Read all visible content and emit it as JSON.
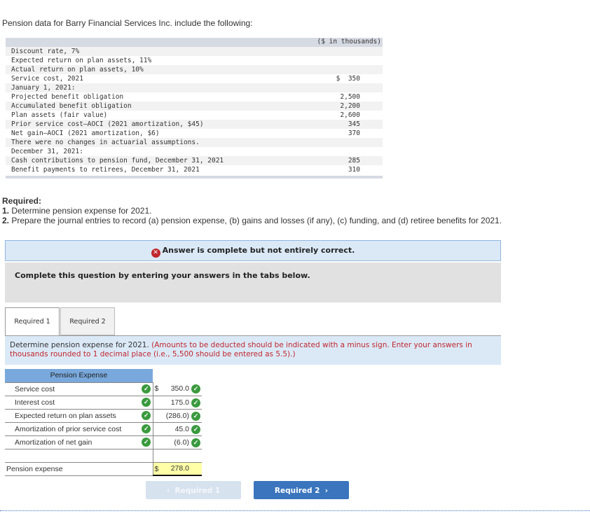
{
  "intro": "Pension data for Barry Financial Services Inc. include the following:",
  "data_table": {
    "unit_header": "($ in thousands)",
    "rows": [
      {
        "label": "Discount rate, 7%",
        "value": ""
      },
      {
        "label": "Expected return on plan assets, 11%",
        "value": ""
      },
      {
        "label": "Actual return on plan assets, 10%",
        "value": ""
      },
      {
        "label": "Service cost, 2021",
        "value": "$  350"
      },
      {
        "label": "January 1, 2021:",
        "value": ""
      },
      {
        "label": "Projected benefit obligation",
        "value": "2,500"
      },
      {
        "label": "Accumulated benefit obligation",
        "value": "2,200"
      },
      {
        "label": "Plan assets (fair value)",
        "value": "2,600"
      },
      {
        "label": "Prior service cost—AOCI (2021 amortization, $45)",
        "value": "345"
      },
      {
        "label": "Net gain—AOCI (2021 amortization, $6)",
        "value": "370"
      },
      {
        "label": "There were no changes in actuarial assumptions.",
        "value": ""
      },
      {
        "label": "December 31, 2021:",
        "value": ""
      },
      {
        "label": "Cash contributions to pension fund, December 31, 2021",
        "value": "285"
      },
      {
        "label": "Benefit payments to retirees, December 31, 2021",
        "value": "310"
      }
    ]
  },
  "required": {
    "heading": "Required:",
    "item1_num": "1.",
    "item1_text": " Determine pension expense for 2021.",
    "item2_num": "2.",
    "item2_text": " Prepare the journal entries to record (a) pension expense, (b) gains and losses (if any), (c) funding, and (d) retiree benefits for 2021."
  },
  "answer_banner": {
    "icon": "x-circle-icon",
    "text": "Answer is complete but not entirely correct."
  },
  "instructions": "Complete this question by entering your answers in the tabs below.",
  "tabs": [
    {
      "label": "Required 1",
      "active": true
    },
    {
      "label": "Required 2",
      "active": false
    }
  ],
  "prompt": {
    "text": "Determine pension expense for 2021. ",
    "note": "(Amounts to be deducted should be indicated with a minus sign. Enter your answers in thousands rounded to 1 decimal place (i.e., 5,500 should be entered as 5.5).)"
  },
  "pension_table": {
    "title": "Pension Expense",
    "rows": [
      {
        "label": "Service cost",
        "currency": "$",
        "amount": "350.0",
        "label_correct": true,
        "amount_correct": true
      },
      {
        "label": "Interest cost",
        "currency": "",
        "amount": "175.0",
        "label_correct": true,
        "amount_correct": true
      },
      {
        "label": "Expected return on plan assets",
        "currency": "",
        "amount": "(286.0)",
        "label_correct": true,
        "amount_correct": true
      },
      {
        "label": "Amortization of prior service cost",
        "currency": "",
        "amount": "45.0",
        "label_correct": true,
        "amount_correct": true
      },
      {
        "label": "Amortization of net gain",
        "currency": "",
        "amount": "(6.0)",
        "label_correct": true,
        "amount_correct": true
      }
    ],
    "total_label": "Pension expense",
    "total_currency": "$",
    "total_amount": "278.0"
  },
  "nav": {
    "prev_label": "Required 1",
    "next_label": "Required 2"
  },
  "colors": {
    "accent": "#3a75bd",
    "correct": "#3a9a3e",
    "incorrect": "#c0272d",
    "header_blue": "#79a8dc",
    "total_highlight": "#ffffa8"
  }
}
